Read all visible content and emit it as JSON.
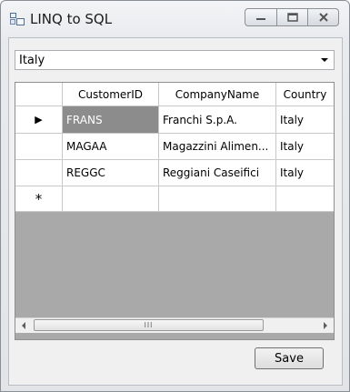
{
  "window": {
    "title": "LINQ to SQL",
    "icons": [
      "window-app-icon",
      "minimize-icon",
      "maximize-icon",
      "close-icon"
    ]
  },
  "filter": {
    "selected": "Italy"
  },
  "grid": {
    "columns": [
      "CustomerID",
      "CompanyName",
      "Country"
    ],
    "rows": [
      {
        "indicator": "▶",
        "cells": [
          "FRANS",
          "Franchi S.p.A.",
          "Italy"
        ]
      },
      {
        "indicator": "",
        "cells": [
          "MAGAA",
          "Magazzini Alimen...",
          "Italy"
        ]
      },
      {
        "indicator": "",
        "cells": [
          "REGGC",
          "Reggiani Caseifici",
          "Italy"
        ]
      },
      {
        "indicator": "*",
        "cells": [
          "",
          "",
          ""
        ]
      }
    ],
    "selected_cell_color": "#8c8c8c",
    "empty_area_color": "#a9a9a9",
    "scroll_thumb_grip": "III"
  },
  "actions": {
    "save_label": "Save"
  }
}
